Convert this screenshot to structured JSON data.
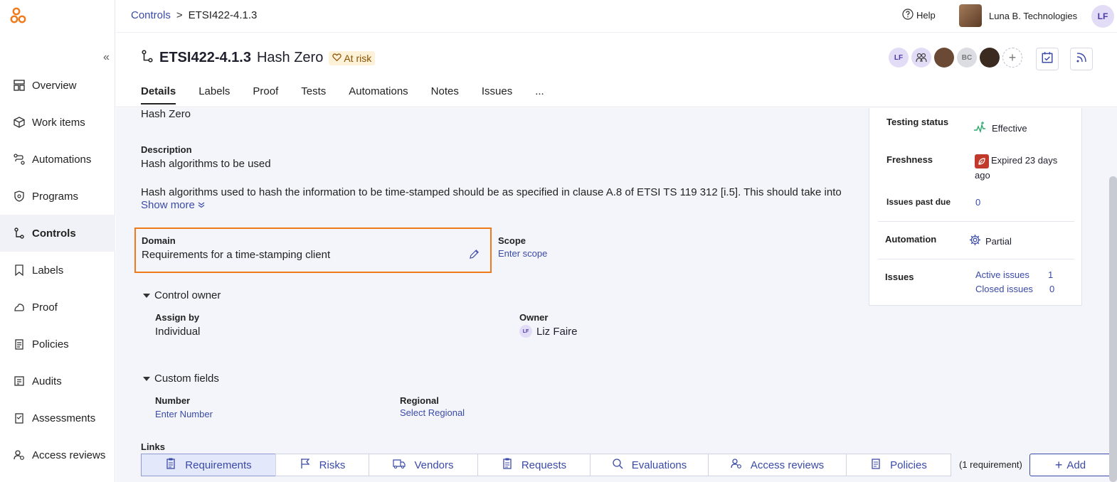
{
  "sidebar": {
    "items": [
      {
        "label": "Overview",
        "icon": "overview-icon"
      },
      {
        "label": "Work items",
        "icon": "box-icon"
      },
      {
        "label": "Automations",
        "icon": "automations-icon"
      },
      {
        "label": "Programs",
        "icon": "shield-icon"
      },
      {
        "label": "Controls",
        "icon": "controls-icon",
        "active": true
      },
      {
        "label": "Labels",
        "icon": "label-icon"
      },
      {
        "label": "Proof",
        "icon": "proof-icon"
      },
      {
        "label": "Policies",
        "icon": "policies-icon"
      },
      {
        "label": "Audits",
        "icon": "audits-icon"
      },
      {
        "label": "Assessments",
        "icon": "assessments-icon"
      },
      {
        "label": "Access reviews",
        "icon": "access-reviews-icon"
      }
    ]
  },
  "topbar": {
    "breadcrumb_root": "Controls",
    "breadcrumb_sep": ">",
    "breadcrumb_current": "ETSI422-4.1.3",
    "help": "Help",
    "org_name": "Luna B. Technologies",
    "user_initials": "LF"
  },
  "header": {
    "code": "ETSI422-4.1.3",
    "name": "Hash Zero",
    "status": "At risk",
    "avatars": [
      "LF",
      "",
      "",
      "BC",
      ""
    ],
    "tabs": [
      "Details",
      "Labels",
      "Proof",
      "Tests",
      "Automations",
      "Notes",
      "Issues",
      "..."
    ]
  },
  "details": {
    "name_value": "Hash Zero",
    "description_label": "Description",
    "description_value": "Hash algorithms to be used",
    "long_text": "Hash algorithms used to hash the information to be time-stamped should be as specified in clause A.8 of ETSI TS 119 312 [i.5]. This should take into",
    "show_more": "Show more",
    "domain_label": "Domain",
    "domain_value": "Requirements for a time-stamping client",
    "scope_label": "Scope",
    "scope_placeholder": "Enter scope",
    "control_owner_label": "Control owner",
    "assign_by_label": "Assign by",
    "assign_by_value": "Individual",
    "owner_label": "Owner",
    "owner_initials": "LF",
    "owner_value": "Liz Faire",
    "custom_fields_label": "Custom fields",
    "number_label": "Number",
    "number_placeholder": "Enter Number",
    "regional_label": "Regional",
    "regional_placeholder": "Select Regional",
    "links_label": "Links"
  },
  "panel": {
    "testing_status_label": "Testing status",
    "testing_status_value": "Effective",
    "freshness_label": "Freshness",
    "freshness_value": "Expired 23 days ago",
    "issues_past_due_label": "Issues past due",
    "issues_past_due_value": "0",
    "automation_label": "Automation",
    "automation_value": "Partial",
    "issues_label": "Issues",
    "active_issues_label": "Active issues",
    "active_issues_value": "1",
    "closed_issues_label": "Closed issues",
    "closed_issues_value": "0"
  },
  "links": {
    "tabs": [
      "Requirements",
      "Risks",
      "Vendors",
      "Requests",
      "Evaluations",
      "Access reviews",
      "Policies"
    ],
    "count_text": "(1 requirement)",
    "add_label": "Add"
  },
  "colors": {
    "accent": "#3a4aa8",
    "highlight": "#f07a1a",
    "risk": "#8a5200",
    "effective": "#2ba86b",
    "expired": "#c0392b"
  }
}
